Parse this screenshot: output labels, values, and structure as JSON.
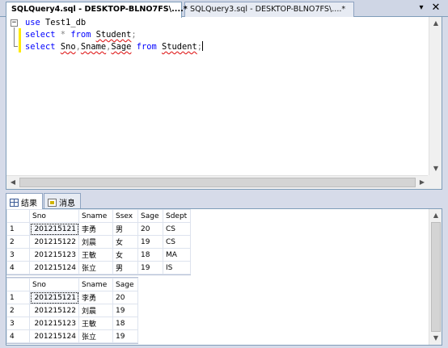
{
  "tabs": [
    {
      "label": "SQLQuery4.sql - DESKTOP-BLNO7FS\\....*",
      "active": true
    },
    {
      "label": "SQLQuery3.sql - DESKTOP-BLNO7FS\\....*",
      "active": false
    }
  ],
  "window_controls": {
    "dropdown": "▾",
    "close": "✕"
  },
  "editor": {
    "lines": [
      [
        {
          "t": "use",
          "c": "kw"
        },
        {
          "t": " Test1_db",
          "c": "id"
        }
      ],
      [
        {
          "t": "select",
          "c": "kw"
        },
        {
          "t": " * ",
          "c": "gr"
        },
        {
          "t": "from",
          "c": "kw"
        },
        {
          "t": " "
        },
        {
          "t": "Student",
          "c": "id",
          "sq": true
        },
        {
          "t": ";",
          "c": "gr"
        }
      ],
      [
        {
          "t": "select",
          "c": "kw"
        },
        {
          "t": " "
        },
        {
          "t": "Sno",
          "c": "id",
          "sq": true
        },
        {
          "t": ",",
          "c": "gr"
        },
        {
          "t": "Sname",
          "c": "id",
          "sq": true
        },
        {
          "t": ",",
          "c": "gr"
        },
        {
          "t": "Sage",
          "c": "id",
          "sq": true
        },
        {
          "t": " "
        },
        {
          "t": "from",
          "c": "kw"
        },
        {
          "t": " "
        },
        {
          "t": "Student",
          "c": "id",
          "sq": true
        },
        {
          "t": ";",
          "c": "gr"
        }
      ]
    ]
  },
  "result_tabs": {
    "results": "结果",
    "messages": "消息"
  },
  "grid1": {
    "columns": [
      "Sno",
      "Sname",
      "Ssex",
      "Sage",
      "Sdept"
    ],
    "rows": [
      [
        "1",
        "201215121",
        "李勇",
        "男",
        "20",
        "CS"
      ],
      [
        "2",
        "201215122",
        "刘晨",
        "女",
        "19",
        "CS"
      ],
      [
        "3",
        "201215123",
        "王敏",
        "女",
        "18",
        "MA"
      ],
      [
        "4",
        "201215124",
        "张立",
        "男",
        "19",
        "IS"
      ]
    ]
  },
  "grid2": {
    "columns": [
      "Sno",
      "Sname",
      "Sage"
    ],
    "rows": [
      [
        "1",
        "201215121",
        "李勇",
        "20"
      ],
      [
        "2",
        "201215122",
        "刘晨",
        "19"
      ],
      [
        "3",
        "201215123",
        "王敏",
        "18"
      ],
      [
        "4",
        "201215124",
        "张立",
        "19"
      ]
    ]
  }
}
